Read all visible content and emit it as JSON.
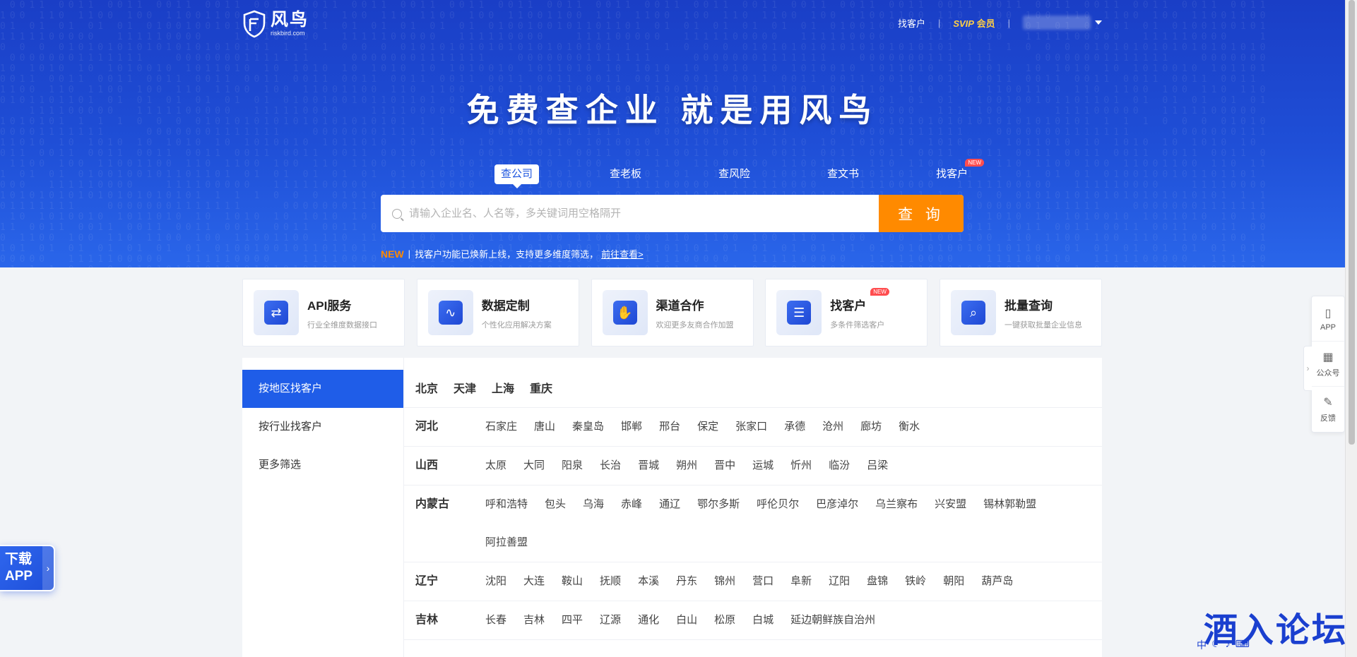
{
  "brand": {
    "name": "风鸟",
    "domain": "riskbird.com"
  },
  "topnav": {
    "find_customers": "找客户",
    "svip_prefix": "SVIP",
    "svip_suffix": "会员"
  },
  "hero": {
    "slogan": "免费查企业 就是用风鸟"
  },
  "search_tabs": [
    {
      "label": "查公司",
      "active": true
    },
    {
      "label": "查老板"
    },
    {
      "label": "查风险"
    },
    {
      "label": "查文书"
    },
    {
      "label": "找客户",
      "badge": "NEW"
    }
  ],
  "search": {
    "placeholder": "请输入企业名、人名等，多关键词用空格隔开",
    "button_label": "查 询"
  },
  "notice": {
    "tag": "NEW",
    "text": "找客户功能已焕新上线，支持更多维度筛选，",
    "link": "前往查看>"
  },
  "services": [
    {
      "title": "API服务",
      "subtitle": "行业全维度数据接口",
      "icon": "api-link-icon"
    },
    {
      "title": "数据定制",
      "subtitle": "个性化应用解决方案",
      "icon": "monitor-chart-icon"
    },
    {
      "title": "渠道合作",
      "subtitle": "欢迎更多友商合作加盟",
      "icon": "handshake-icon"
    },
    {
      "title": "找客户",
      "subtitle": "多条件筛选客户",
      "icon": "document-search-icon",
      "badge": "NEW"
    },
    {
      "title": "批量查询",
      "subtitle": "一键获取批量企业信息",
      "icon": "batch-search-icon"
    }
  ],
  "sidebar": {
    "items": [
      {
        "label": "按地区找客户",
        "active": true
      },
      {
        "label": "按行业找客户"
      },
      {
        "label": "更多筛选"
      }
    ]
  },
  "municipalities": [
    "北京",
    "天津",
    "上海",
    "重庆"
  ],
  "provinces": [
    {
      "name": "河北",
      "cities": [
        "石家庄",
        "唐山",
        "秦皇岛",
        "邯郸",
        "邢台",
        "保定",
        "张家口",
        "承德",
        "沧州",
        "廊坊",
        "衡水"
      ]
    },
    {
      "name": "山西",
      "cities": [
        "太原",
        "大同",
        "阳泉",
        "长治",
        "晋城",
        "朔州",
        "晋中",
        "运城",
        "忻州",
        "临汾",
        "吕梁"
      ]
    },
    {
      "name": "内蒙古",
      "cities": [
        "呼和浩特",
        "包头",
        "乌海",
        "赤峰",
        "通辽",
        "鄂尔多斯",
        "呼伦贝尔",
        "巴彦淖尔",
        "乌兰察布",
        "兴安盟",
        "锡林郭勒盟",
        "阿拉善盟"
      ]
    },
    {
      "name": "辽宁",
      "cities": [
        "沈阳",
        "大连",
        "鞍山",
        "抚顺",
        "本溪",
        "丹东",
        "锦州",
        "营口",
        "阜新",
        "辽阳",
        "盘锦",
        "铁岭",
        "朝阳",
        "葫芦岛"
      ]
    },
    {
      "name": "吉林",
      "cities": [
        "长春",
        "吉林",
        "四平",
        "辽源",
        "通化",
        "白山",
        "松原",
        "白城",
        "延边朝鲜族自治州"
      ]
    }
  ],
  "float_panel": [
    {
      "label": "APP",
      "icon": "phone-icon"
    },
    {
      "label": "公众号",
      "icon": "qrcode-icon"
    },
    {
      "label": "反馈",
      "icon": "edit-icon"
    }
  ],
  "download_app": {
    "line1": "下载",
    "line2": "APP"
  },
  "watermark": "酒入论坛",
  "colors": {
    "brand_blue": "#1f5de8",
    "search_orange": "#ff8a00",
    "svip_gold": "#ffcf45",
    "badge_red": "#ff4d4f"
  }
}
